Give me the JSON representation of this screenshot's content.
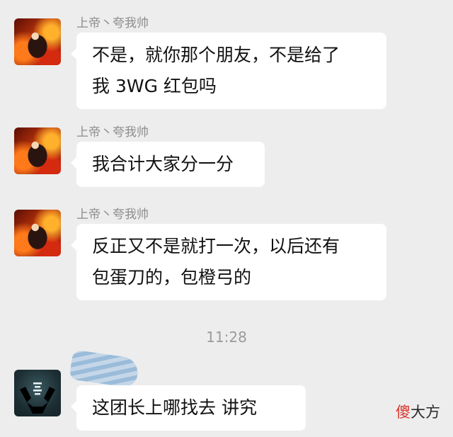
{
  "messages": [
    {
      "sender": "上帝丶夸我帅",
      "lines": [
        "不是，就你那个朋友，不是给了",
        "我 3WG 红包吗"
      ]
    },
    {
      "sender": "上帝丶夸我帅",
      "lines": [
        "我合计大家分一分"
      ]
    },
    {
      "sender": "上帝丶夸我帅",
      "lines": [
        "反正又不是就打一次，以后还有",
        "包蛋刀的，包橙弓的"
      ]
    },
    {
      "sender": "",
      "lines": [
        "这团长上哪找去 讲究"
      ]
    }
  ],
  "timestamp": "11:28",
  "watermark": {
    "first_char": "傻",
    "rest": "大方"
  }
}
